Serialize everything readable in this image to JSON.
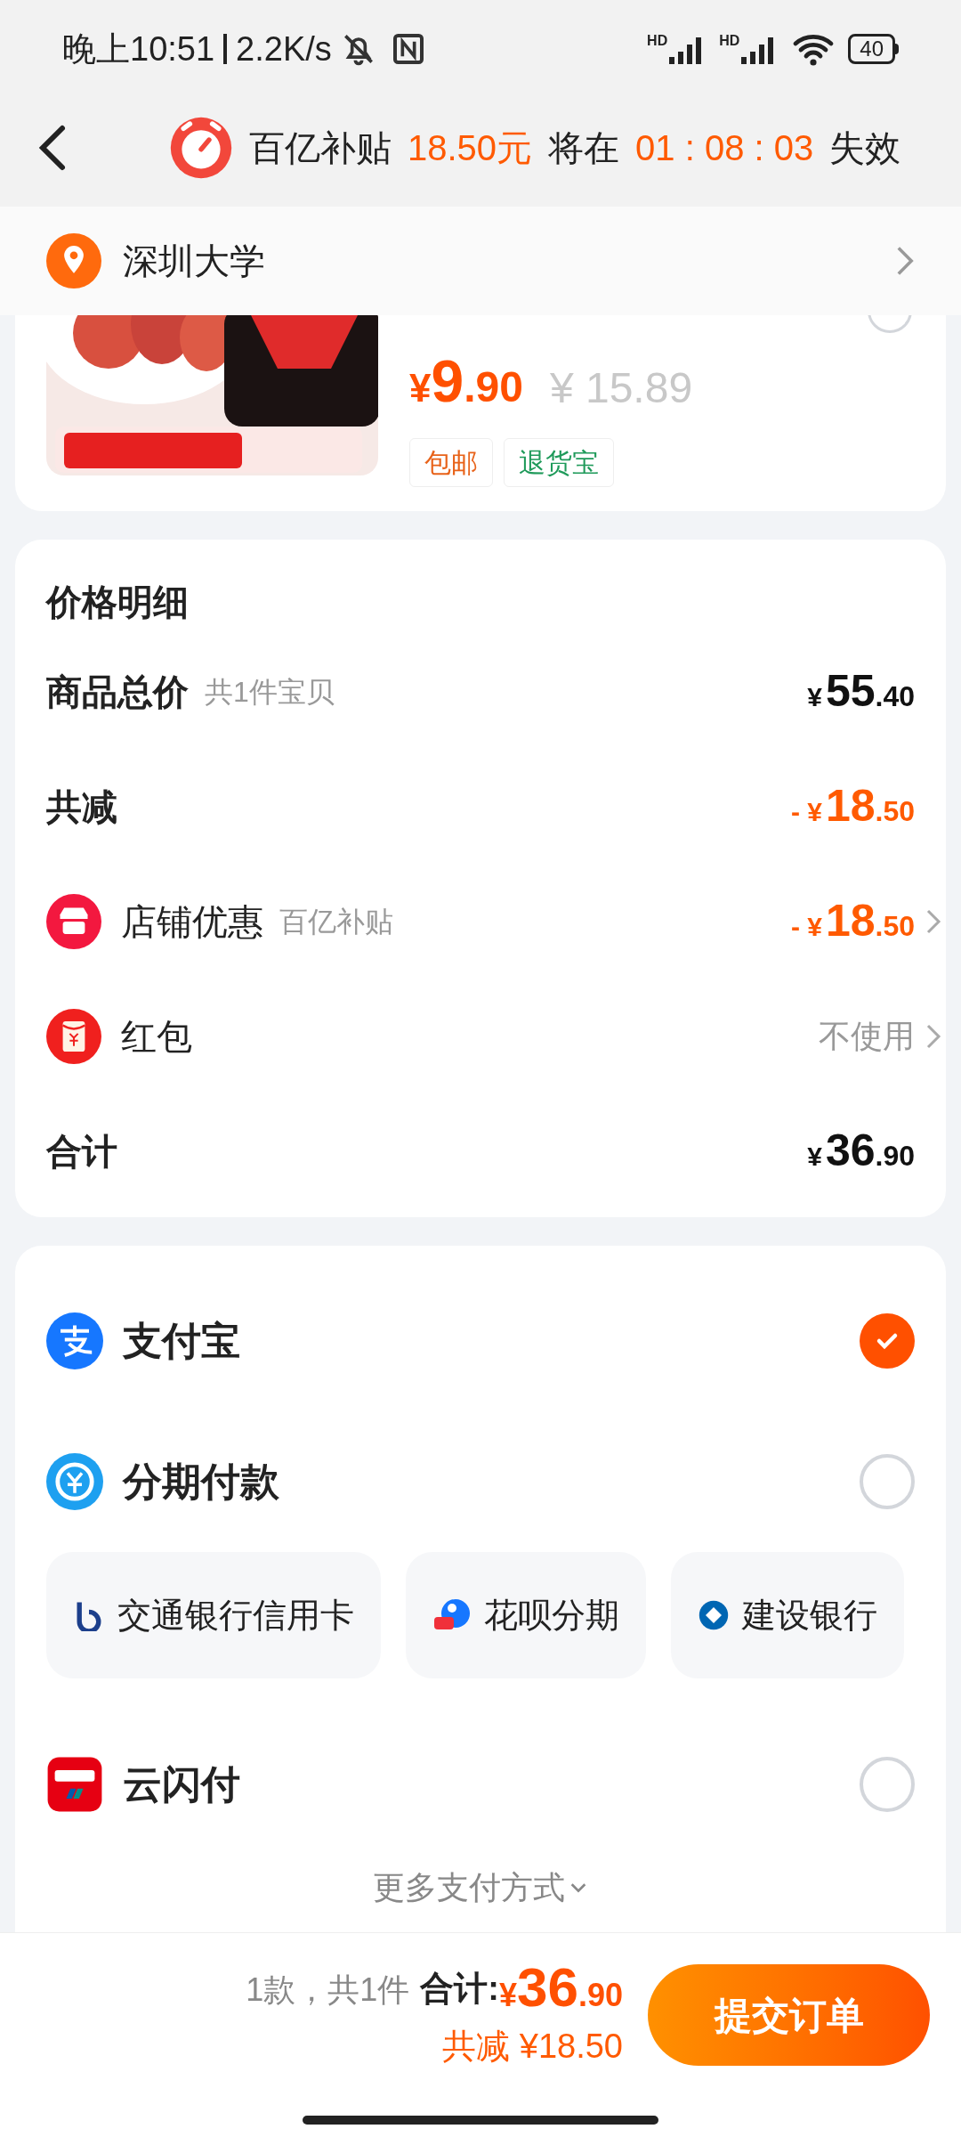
{
  "status_bar": {
    "time": "晚上10:51",
    "speed": "2.2K/s",
    "signals": [
      {
        "label": "HD"
      },
      {
        "label": "HD"
      }
    ],
    "battery": "40"
  },
  "banner": {
    "segments": [
      {
        "text": "百亿补贴",
        "highlight": false
      },
      {
        "text": "18.50元",
        "highlight": true
      },
      {
        "text": "将在",
        "highlight": false
      },
      {
        "text": "01 : 08 : 03",
        "highlight": true
      },
      {
        "text": "失效",
        "highlight": false
      }
    ]
  },
  "address": {
    "text": "深圳大学"
  },
  "product": {
    "selected": false,
    "price": {
      "symbol": "¥",
      "integer": "9",
      "decimal": ".90"
    },
    "original_price": "¥ 15.89",
    "tags": [
      {
        "text": "包邮",
        "color": "#e8631a"
      },
      {
        "text": "退货宝",
        "color": "#1f9a5a"
      }
    ]
  },
  "price_details": {
    "title": "价格明细",
    "rows": [
      {
        "kind": "plain",
        "label": "商品总价",
        "note": "共1件宝贝",
        "amount": {
          "prefix": "¥",
          "integer": "55",
          "decimal": ".40"
        },
        "discount": false,
        "chevron": false
      },
      {
        "kind": "plain",
        "label": "共减",
        "amount": {
          "prefix": "- ¥",
          "integer": "18",
          "decimal": ".50"
        },
        "discount": true,
        "chevron": false
      },
      {
        "kind": "shop",
        "label": "店铺优惠",
        "note": "百亿补贴",
        "amount": {
          "prefix": "- ¥",
          "integer": "18",
          "decimal": ".50"
        },
        "discount": true,
        "chevron": true
      },
      {
        "kind": "redpacket",
        "label": "红包",
        "value": "不使用",
        "chevron": true
      },
      {
        "kind": "plain",
        "label": "合计",
        "amount": {
          "prefix": "¥",
          "integer": "36",
          "decimal": ".90"
        },
        "discount": false,
        "chevron": false
      }
    ]
  },
  "payment_methods": [
    {
      "kind": "alipay",
      "name": "支付宝",
      "selected": true
    },
    {
      "kind": "installment",
      "name": "分期付款",
      "selected": false,
      "options": [
        {
          "kind": "bocom",
          "label": "交通银行信用卡"
        },
        {
          "kind": "huabei",
          "label": "花呗分期"
        },
        {
          "kind": "ccb",
          "label": "建设银行"
        }
      ]
    },
    {
      "kind": "unionpay",
      "name": "云闪付",
      "selected": false
    }
  ],
  "more_payment": "更多支付方式",
  "bottom_bar": {
    "count": "1款，共1件",
    "total_label": "合计:",
    "total": {
      "prefix": "¥",
      "integer": "36",
      "decimal": ".90"
    },
    "saved": "共减 ¥18.50",
    "submit": "提交订单"
  }
}
